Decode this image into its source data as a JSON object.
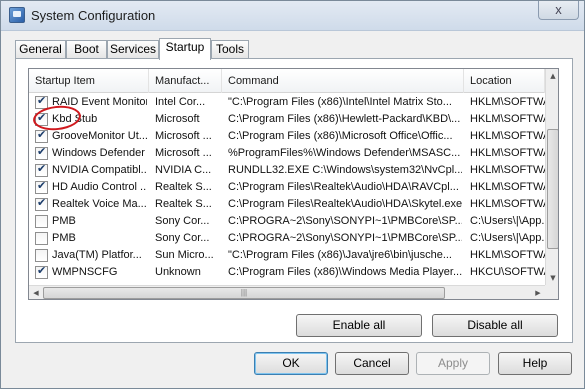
{
  "window": {
    "title": "System Configuration",
    "close_label": "x"
  },
  "tabs": [
    {
      "label": "General"
    },
    {
      "label": "Boot"
    },
    {
      "label": "Services"
    },
    {
      "label": "Startup"
    },
    {
      "label": "Tools"
    }
  ],
  "active_tab": "Startup",
  "table": {
    "columns": [
      "Startup Item",
      "Manufact...",
      "Command",
      "Location"
    ],
    "rows": [
      {
        "checked": true,
        "item": "RAID Event Monitor",
        "manufacturer": "Intel Cor...",
        "command": "\"C:\\Program Files (x86)\\Intel\\Intel Matrix Sto...",
        "location": "HKLM\\SOFTWA..."
      },
      {
        "checked": true,
        "item": "Kbd Stub",
        "manufacturer": "Microsoft",
        "command": "C:\\Program Files (x86)\\Hewlett-Packard\\KBD\\...",
        "location": "HKLM\\SOFTWA..."
      },
      {
        "checked": true,
        "item": "GrooveMonitor Ut...",
        "manufacturer": "Microsoft ...",
        "command": "C:\\Program Files (x86)\\Microsoft Office\\Offic...",
        "location": "HKLM\\SOFTWA..."
      },
      {
        "checked": true,
        "item": "Windows Defender",
        "manufacturer": "Microsoft ...",
        "command": "%ProgramFiles%\\Windows Defender\\MSASC...",
        "location": "HKLM\\SOFTWA..."
      },
      {
        "checked": true,
        "item": "NVIDIA Compatibl...",
        "manufacturer": "NVIDIA C...",
        "command": "RUNDLL32.EXE C:\\Windows\\system32\\NvCpl...",
        "location": "HKLM\\SOFTWA..."
      },
      {
        "checked": true,
        "item": "HD Audio Control ...",
        "manufacturer": "Realtek S...",
        "command": "C:\\Program Files\\Realtek\\Audio\\HDA\\RAVCpl...",
        "location": "HKLM\\SOFTWA..."
      },
      {
        "checked": true,
        "item": "Realtek Voice  Ma...",
        "manufacturer": "Realtek S...",
        "command": "C:\\Program Files\\Realtek\\Audio\\HDA\\Skytel.exe",
        "location": "HKLM\\SOFTWA..."
      },
      {
        "checked": false,
        "item": "PMB",
        "manufacturer": "Sony Cor...",
        "command": "C:\\PROGRA~2\\Sony\\SONYPI~1\\PMBCore\\SP...",
        "location": "C:\\Users\\|\\App..."
      },
      {
        "checked": false,
        "item": "PMB",
        "manufacturer": "Sony Cor...",
        "command": "C:\\PROGRA~2\\Sony\\SONYPI~1\\PMBCore\\SP...",
        "location": "C:\\Users\\|\\App..."
      },
      {
        "checked": false,
        "item": "Java(TM) Platfor...",
        "manufacturer": "Sun Micro...",
        "command": "\"C:\\Program Files (x86)\\Java\\jre6\\bin\\jusche...",
        "location": "HKLM\\SOFTWA..."
      },
      {
        "checked": true,
        "item": "WMPNSCFG",
        "manufacturer": "Unknown",
        "command": "C:\\Program Files (x86)\\Windows Media Player...",
        "location": "HKCU\\SOFTWA..."
      }
    ]
  },
  "buttons": {
    "enable_all": "Enable all",
    "disable_all": "Disable all",
    "ok": "OK",
    "cancel": "Cancel",
    "apply": "Apply",
    "help": "Help"
  },
  "scroll": {
    "up": "▲",
    "down": "▼",
    "left": "◀",
    "right": "▶",
    "grip": "|||"
  }
}
